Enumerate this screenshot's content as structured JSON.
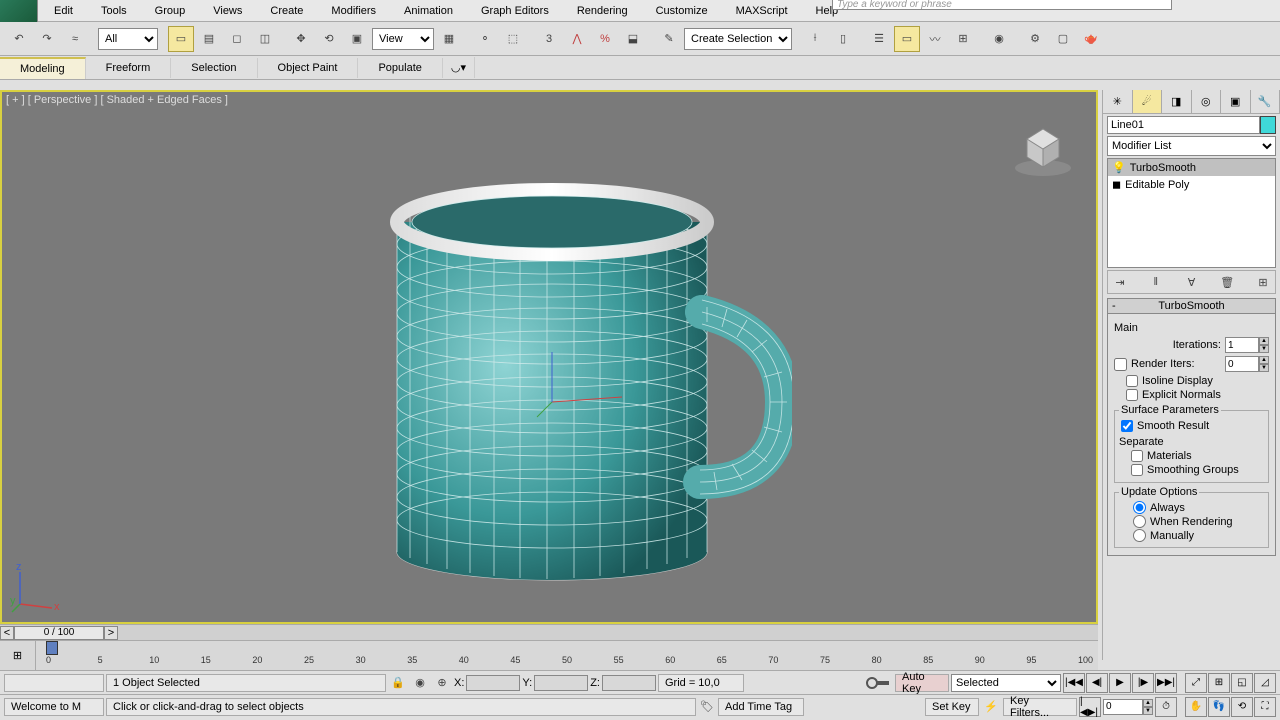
{
  "search_placeholder": "Type a keyword or phrase",
  "menu": [
    "Edit",
    "Tools",
    "Group",
    "Views",
    "Create",
    "Modifiers",
    "Animation",
    "Graph Editors",
    "Rendering",
    "Customize",
    "MAXScript",
    "Help"
  ],
  "toolbar": {
    "filter": "All",
    "refcoord": "View",
    "sel_set": "Create Selection Se"
  },
  "ribbon": [
    "Modeling",
    "Freeform",
    "Selection",
    "Object Paint",
    "Populate"
  ],
  "ribbon_active": 0,
  "viewport": {
    "label": "[ + ] [ Perspective ] [ Shaded + Edged Faces ]"
  },
  "cmdpanel": {
    "object_name": "Line01",
    "modifier_list": "Modifier List",
    "stack": [
      "TurboSmooth",
      "Editable Poly"
    ],
    "stack_sel": 0,
    "rollout_title": "TurboSmooth",
    "main_label": "Main",
    "iterations_label": "Iterations:",
    "iterations": "1",
    "render_iters_label": "Render Iters:",
    "render_iters": "0",
    "isoline": "Isoline Display",
    "explicit": "Explicit Normals",
    "surf_params": "Surface Parameters",
    "smooth_result": "Smooth Result",
    "separate": "Separate",
    "materials": "Materials",
    "smoothing_groups": "Smoothing Groups",
    "update_options": "Update Options",
    "update_always": "Always",
    "update_render": "When Rendering",
    "update_manual": "Manually"
  },
  "timeline": {
    "frame": "0 / 100",
    "ticks": [
      0,
      5,
      10,
      15,
      20,
      25,
      30,
      35,
      40,
      45,
      50,
      55,
      60,
      65,
      70,
      75,
      80,
      85,
      90,
      95,
      100
    ]
  },
  "status": {
    "selected": "1 Object Selected",
    "x": "X:",
    "y": "Y:",
    "z": "Z:",
    "grid": "Grid = 10,0",
    "autokey": "Auto Key",
    "setkey": "Set Key",
    "selected_drop": "Selected",
    "keyfilters": "Key Filters...",
    "welcome": "Welcome to M",
    "prompt": "Click or click-and-drag to select objects",
    "addtag": "Add Time Tag",
    "frame_in": "0"
  }
}
